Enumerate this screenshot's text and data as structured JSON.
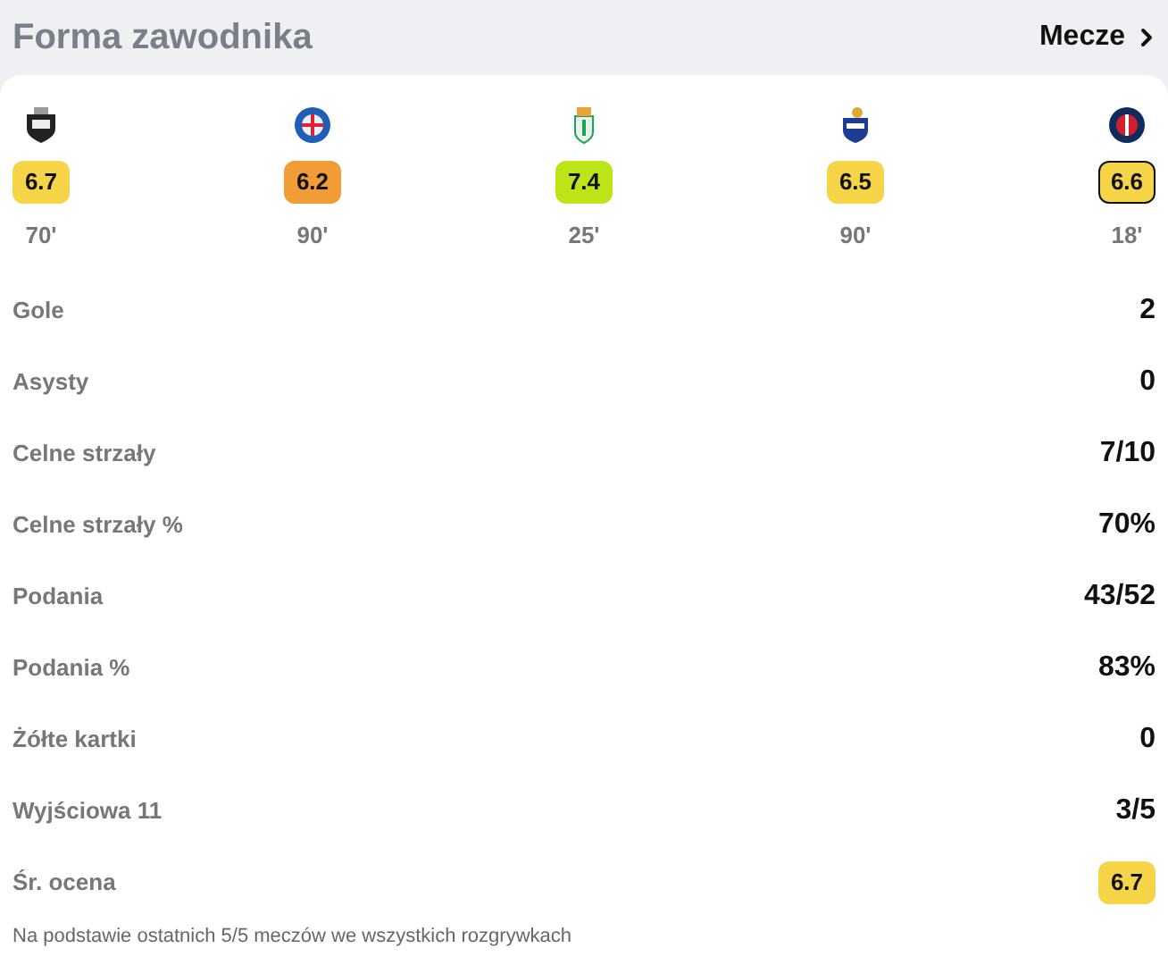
{
  "header": {
    "title": "Forma zawodnika",
    "link": "Mecze"
  },
  "matches": [
    {
      "rating": "6.7",
      "color": "#f5d547",
      "minutes": "70'",
      "selected": false
    },
    {
      "rating": "6.2",
      "color": "#f29c38",
      "minutes": "90'",
      "selected": false
    },
    {
      "rating": "7.4",
      "color": "#bde417",
      "minutes": "25'",
      "selected": false
    },
    {
      "rating": "6.5",
      "color": "#f5d547",
      "minutes": "90'",
      "selected": false
    },
    {
      "rating": "6.6",
      "color": "#f5d547",
      "minutes": "18'",
      "selected": true
    }
  ],
  "stats": [
    {
      "kind": "text",
      "label": "Gole",
      "value": "2"
    },
    {
      "kind": "text",
      "label": "Asysty",
      "value": "0"
    },
    {
      "kind": "text",
      "label": "Celne strzały",
      "value": "7/10"
    },
    {
      "kind": "text",
      "label": "Celne strzały %",
      "value": "70%"
    },
    {
      "kind": "text",
      "label": "Podania",
      "value": "43/52"
    },
    {
      "kind": "text",
      "label": "Podania %",
      "value": "83%"
    },
    {
      "kind": "text",
      "label": "Żółte kartki",
      "value": "0"
    },
    {
      "kind": "text",
      "label": "Wyjściowa 11",
      "value": "3/5"
    },
    {
      "kind": "rating",
      "label": "Śr. ocena",
      "value": "6.7",
      "color": "#f5d547"
    }
  ],
  "footnote": "Na podstawie ostatnich 5/5 meczów we wszystkich rozgrywkach"
}
